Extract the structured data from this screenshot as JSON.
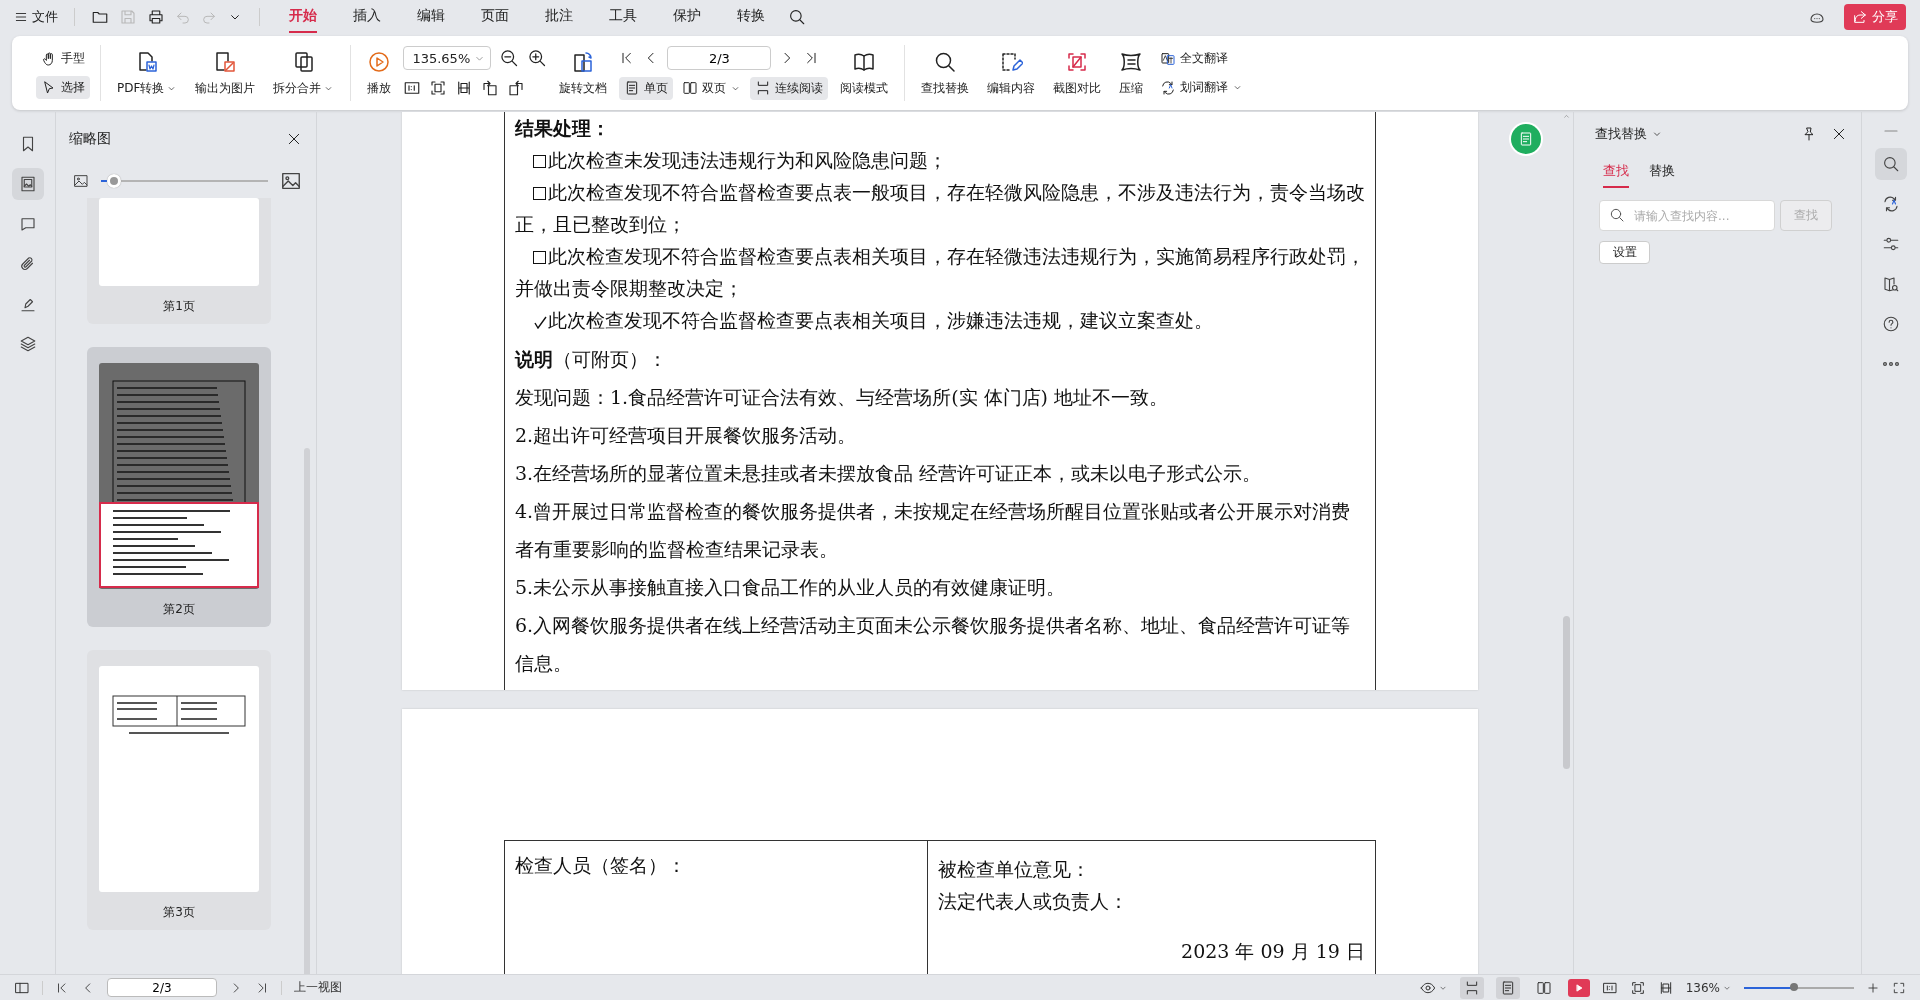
{
  "menubar": {
    "file_menu": "文件",
    "tabs": [
      {
        "label": "开始",
        "selected": true
      },
      {
        "label": "插入",
        "selected": false
      },
      {
        "label": "编辑",
        "selected": false
      },
      {
        "label": "页面",
        "selected": false
      },
      {
        "label": "批注",
        "selected": false
      },
      {
        "label": "工具",
        "selected": false
      },
      {
        "label": "保护",
        "selected": false
      },
      {
        "label": "转换",
        "selected": false
      }
    ],
    "share_button": "分享"
  },
  "toolbar": {
    "hand_tool": {
      "label": "手型",
      "selected": false
    },
    "select_tool": {
      "label": "选择",
      "selected": true
    },
    "convert_buttons": [
      {
        "label": "PDF转换",
        "dropdown": true
      },
      {
        "label": "输出为图片",
        "dropdown": false
      },
      {
        "label": "拆分合并",
        "dropdown": true
      }
    ],
    "play_button": "播放",
    "zoom_field": {
      "value": "135.65%"
    },
    "rotate_button": "旋转文档",
    "page_field": {
      "value": "2/3"
    },
    "view_modes": [
      {
        "label": "单页",
        "selected": true,
        "dropdown": false
      },
      {
        "label": "双页",
        "selected": false,
        "dropdown": true
      },
      {
        "label": "连续阅读",
        "selected": true,
        "dropdown": false
      }
    ],
    "read_mode_button": "阅读模式",
    "tool_buttons": [
      "查找替换",
      "编辑内容",
      "截图对比",
      "压缩"
    ],
    "translate_buttons": [
      {
        "label": "全文翻译",
        "dropdown": false
      },
      {
        "label": "划词翻译",
        "dropdown": true
      }
    ]
  },
  "left_rail": [
    {
      "selected": false
    },
    {
      "selected": true
    },
    {
      "selected": false
    },
    {
      "selected": false
    },
    {
      "selected": false
    },
    {
      "selected": false
    }
  ],
  "thumbnails": {
    "title": "缩略图",
    "size_slider": {
      "level": 0.08
    },
    "pages": [
      {
        "label": "第1页",
        "selected": false
      },
      {
        "label": "第2页",
        "selected": true
      },
      {
        "label": "第3页",
        "selected": false
      }
    ]
  },
  "document": {
    "page_1": [
      {
        "kind": "heading",
        "text": "结果处理："
      },
      {
        "kind": "checkbox",
        "checked": false,
        "text": "此次检查未发现违法违规行为和风险隐患问题；"
      },
      {
        "kind": "checkbox",
        "checked": false,
        "text": "此次检查发现不符合监督检查要点表一般项目，存在轻微风险隐患，不涉及违法行为，责令当场改正，且已整改到位；"
      },
      {
        "kind": "checkbox",
        "checked": false,
        "text": "此次检查发现不符合监督检查要点表相关项目，存在轻微违法违规行为，实施简易程序行政处罚，并做出责令限期整改决定；"
      },
      {
        "kind": "checkbox",
        "checked": true,
        "text": "此次检查发现不符合监督检查要点表相关项目，涉嫌违法违规，建议立案查处。"
      },
      {
        "kind": "note",
        "text": "**说明**（可附页）："
      },
      {
        "kind": "body",
        "text": " 发现问题：1.食品经营许可证合法有效、与经营场所(实 体门店) 地址不一致。"
      },
      {
        "kind": "body",
        "text": "2.超出许可经营项目开展餐饮服务活动。"
      },
      {
        "kind": "body",
        "text": "3.在经营场所的显著位置未悬挂或者未摆放食品 经营许可证正本，或未以电子形式公示。"
      },
      {
        "kind": "body",
        "text": "4.曾开展过日常监督检查的餐饮服务提供者，未按规定在经营场所醒目位置张贴或者公开展示对消费者有重要影响的监督检查结果记录表。"
      },
      {
        "kind": "body",
        "text": "5.未公示从事接触直接入口食品工作的从业人员的有效健康证明。"
      },
      {
        "kind": "body",
        "text": "6.入网餐饮服务提供者在线上经营活动主页面未公示餐饮服务提供者名称、地址、食品经营许可证等信息。"
      }
    ],
    "page_2": {
      "inspector_cell": "检查人员（签名）：",
      "unit_opinion": "被检查单位意见：",
      "representative": "法定代表人或负责人：",
      "date": "2023 年 09 月 19 日"
    }
  },
  "find_panel": {
    "title": "查找替换",
    "tabs": [
      {
        "label": "查找",
        "selected": true
      },
      {
        "label": "替换",
        "selected": false
      }
    ],
    "search_field": {
      "placeholder": "请输入查找内容..."
    },
    "find_button": {
      "label": "查找",
      "disabled": true
    },
    "settings_button": "设置"
  },
  "right_rail": [
    {
      "selected": true
    },
    {
      "selected": false
    },
    {
      "selected": false
    },
    {
      "selected": false
    },
    {
      "selected": false
    },
    {
      "selected": false
    }
  ],
  "status_bar": {
    "page_field": {
      "value": "2/3"
    },
    "previous_view": "上一视图",
    "view_buttons": [
      {
        "selected": true
      },
      {
        "selected": true
      },
      {
        "selected": false
      }
    ],
    "zoom_label": "136%",
    "zoom_slider": {
      "level": 0.45
    }
  }
}
